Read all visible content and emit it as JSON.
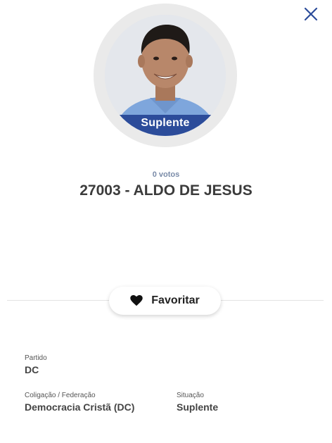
{
  "close": {
    "icon": "close-icon"
  },
  "candidate": {
    "status_banner": "Suplente",
    "votes": "0 votos",
    "title": "27003 - ALDO DE JESUS"
  },
  "favorite": {
    "icon": "heart-icon",
    "label": "Favoritar"
  },
  "details": {
    "party_label": "Partido",
    "party_value": "DC",
    "coalition_label": "Coligação / Federação",
    "coalition_value": "Democracia Cristã (DC)",
    "situation_label": "Situação",
    "situation_value": "Suplente"
  },
  "colors": {
    "accent": "#2c4c9a",
    "close": "#2c4c9a"
  }
}
